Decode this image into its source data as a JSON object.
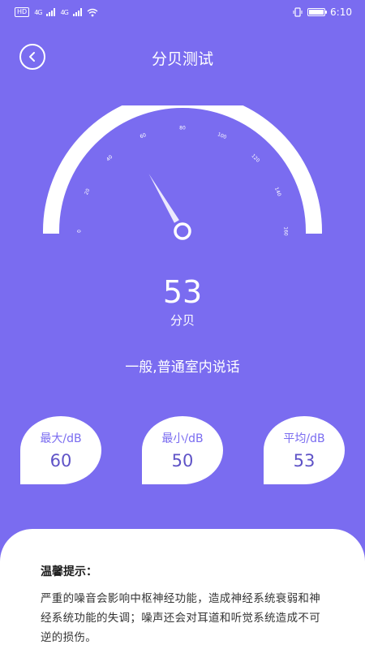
{
  "status_bar": {
    "badge": "HD",
    "net_1": "4G",
    "net_2": "4G",
    "time": "6:10"
  },
  "header": {
    "title": "分贝测试"
  },
  "gauge": {
    "ticks": [
      "0",
      "20",
      "40",
      "60",
      "80",
      "100",
      "120",
      "140",
      "160"
    ],
    "value_db": 53,
    "max_db": 160,
    "track_color": "#ffffff",
    "needle_color": "#ffffff"
  },
  "reading": {
    "value": "53",
    "unit": "分贝"
  },
  "description": "一般,普通室内说话",
  "stats": [
    {
      "label": "最大/dB",
      "value": "60"
    },
    {
      "label": "最小/dB",
      "value": "50"
    },
    {
      "label": "平均/dB",
      "value": "53"
    }
  ],
  "tips": {
    "title": "温馨提示：",
    "text": "严重的噪音会影响中枢神经功能，造成神经系统衰弱和神经系统功能的失调；噪声还会对耳道和听觉系统造成不可逆的损伤。"
  },
  "colors": {
    "background": "#7a6cf0",
    "accent_text": "#5f53c7"
  }
}
